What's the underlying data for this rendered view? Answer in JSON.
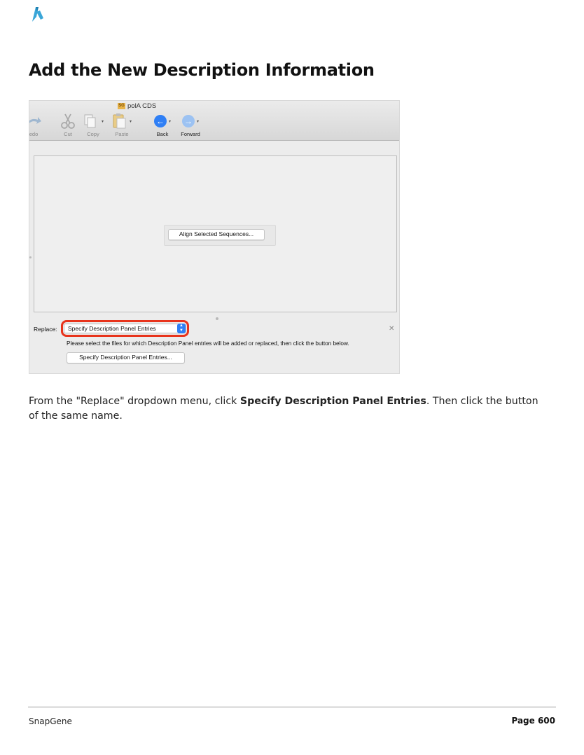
{
  "page": {
    "heading": "Add the New Description Information",
    "footer_left": "SnapGene",
    "footer_right": "Page 600",
    "logo_icon": "snapgene-logo-icon"
  },
  "screenshot": {
    "window_title": "polA CDS",
    "doc_badge": "SG",
    "toolbar": [
      {
        "label": "Redo",
        "icon": "redo-icon"
      },
      {
        "label": "Cut",
        "icon": "scissors-icon"
      },
      {
        "label": "Copy",
        "icon": "copy-icon"
      },
      {
        "label": "Paste",
        "icon": "paste-icon"
      },
      {
        "label": "Back",
        "icon": "back-arrow-icon"
      },
      {
        "label": "Forward",
        "icon": "forward-arrow-icon"
      }
    ],
    "redo_visible_label": "edo",
    "align_button": "Align Selected Sequences...",
    "replace_label": "Replace:",
    "replace_selected": "Specify Description Panel Entries",
    "hint_text": "Please select the files for which Description Panel entries will be added or replaced, then click the button below.",
    "specify_button": "Specify Description Panel Entries...",
    "highlight_color": "#e8341c",
    "accent_color": "#2f7ff5"
  },
  "body": {
    "text_before": "From the \"Replace\" dropdown menu, click ",
    "bold": "Specify Description Panel Entries",
    "text_after": ". Then click the button of the same name."
  }
}
